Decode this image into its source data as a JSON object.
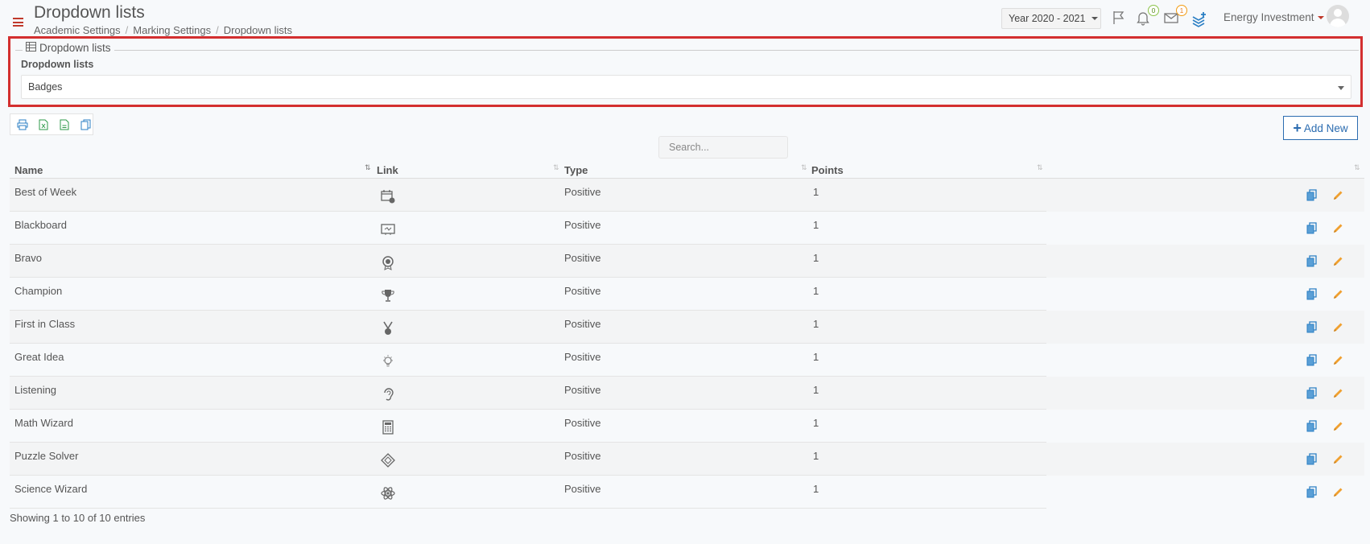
{
  "header": {
    "title": "Dropdown lists",
    "breadcrumb": [
      "Academic Settings",
      "Marking Settings",
      "Dropdown lists"
    ],
    "year": "Year 2020 - 2021",
    "notifications_count": "0",
    "messages_count": "1",
    "user_name": "Energy Investment"
  },
  "panel": {
    "legend": "Dropdown lists",
    "field_label": "Dropdown lists",
    "selected_list": "Badges"
  },
  "toolbar": {
    "add_new_label": "Add New",
    "search_placeholder": "Search..."
  },
  "table": {
    "columns": [
      "Name",
      "Link",
      "Type",
      "Points"
    ],
    "rows": [
      {
        "name": "Best of Week",
        "icon": "calendar-badge-icon",
        "type": "Positive",
        "points": "1"
      },
      {
        "name": "Blackboard",
        "icon": "blackboard-icon",
        "type": "Positive",
        "points": "1"
      },
      {
        "name": "Bravo",
        "icon": "medal-icon",
        "type": "Positive",
        "points": "1"
      },
      {
        "name": "Champion",
        "icon": "trophy-icon",
        "type": "Positive",
        "points": "1"
      },
      {
        "name": "First in Class",
        "icon": "ribbon-medal-icon",
        "type": "Positive",
        "points": "1"
      },
      {
        "name": "Great Idea",
        "icon": "lightbulb-icon",
        "type": "Positive",
        "points": "1"
      },
      {
        "name": "Listening",
        "icon": "ear-icon",
        "type": "Positive",
        "points": "1"
      },
      {
        "name": "Math Wizard",
        "icon": "calculator-icon",
        "type": "Positive",
        "points": "1"
      },
      {
        "name": "Puzzle Solver",
        "icon": "puzzle-icon",
        "type": "Positive",
        "points": "1"
      },
      {
        "name": "Science Wizard",
        "icon": "atom-icon",
        "type": "Positive",
        "points": "1"
      }
    ],
    "info": "Showing 1 to 10 of 10 entries"
  },
  "colors": {
    "accent": "#2b6cb0",
    "highlight": "#d32f2f",
    "edit": "#f0a030",
    "copy": "#2b7fc4"
  }
}
